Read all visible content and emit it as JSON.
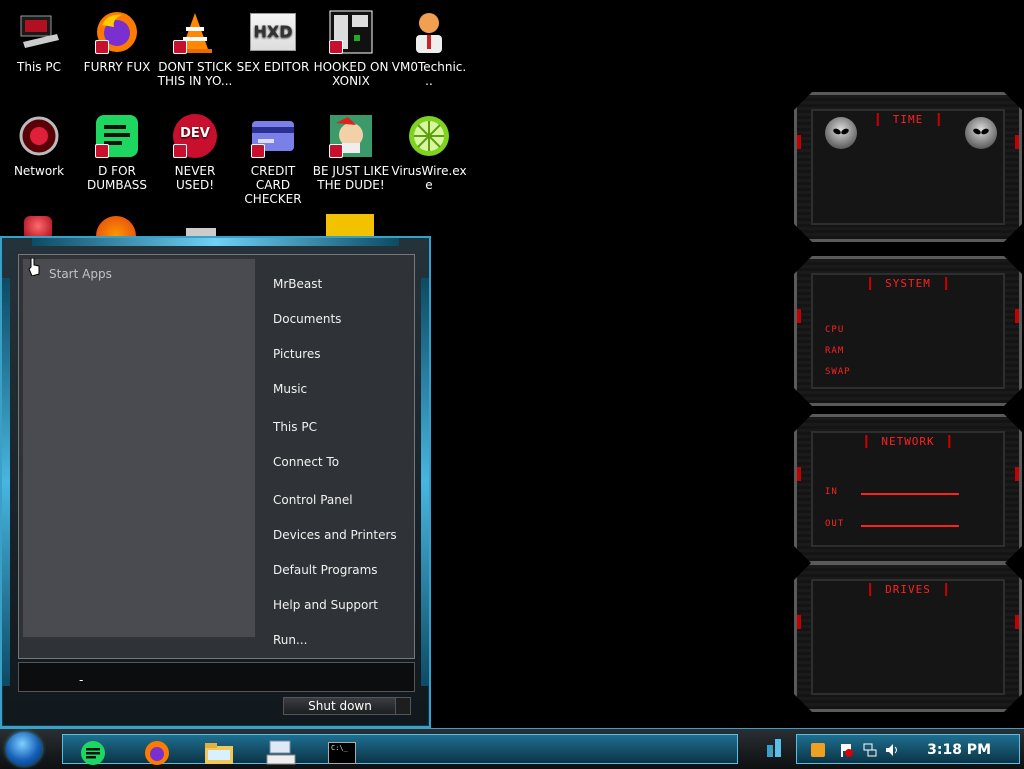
{
  "desktop": {
    "icons": [
      {
        "label": "This PC"
      },
      {
        "label": "FURRY FUX"
      },
      {
        "label": "DONT STICK THIS IN YO..."
      },
      {
        "label": "SEX EDITOR"
      },
      {
        "label": "HOOKED ON XONIX"
      },
      {
        "label": "VM0Technic..."
      },
      {
        "label": "Network"
      },
      {
        "label": "D FOR DUMBASS"
      },
      {
        "label": "NEVER USED!"
      },
      {
        "label": "CREDIT CARD CHECKER"
      },
      {
        "label": "BE JUST LIKE THE DUDE!"
      },
      {
        "label": "VirusWire.exe"
      }
    ],
    "icon_texts": {
      "hxd": "HXD",
      "dev": "DEV"
    }
  },
  "start_menu": {
    "apps_title": "Start Apps",
    "places": [
      "MrBeast",
      "Documents",
      "Pictures",
      "Music",
      "This PC",
      "Connect To",
      "Control Panel",
      "Devices and Printers",
      "Default Programs",
      "Help and Support",
      "Run..."
    ],
    "search_caret": "-",
    "shutdown_label": "Shut down"
  },
  "gadgets": {
    "time": {
      "title": "TIME"
    },
    "system": {
      "title": "SYSTEM",
      "labels": [
        "CPU",
        "RAM",
        "SWAP"
      ]
    },
    "network": {
      "title": "NETWORK",
      "labels": [
        "IN",
        "OUT"
      ]
    },
    "drives": {
      "title": "DRIVES"
    },
    "accent_color": "#ff2020"
  },
  "taskbar": {
    "clock": "3:18 PM",
    "cmd_text": "C:\\_",
    "accent_color": "#3aa0c8"
  }
}
